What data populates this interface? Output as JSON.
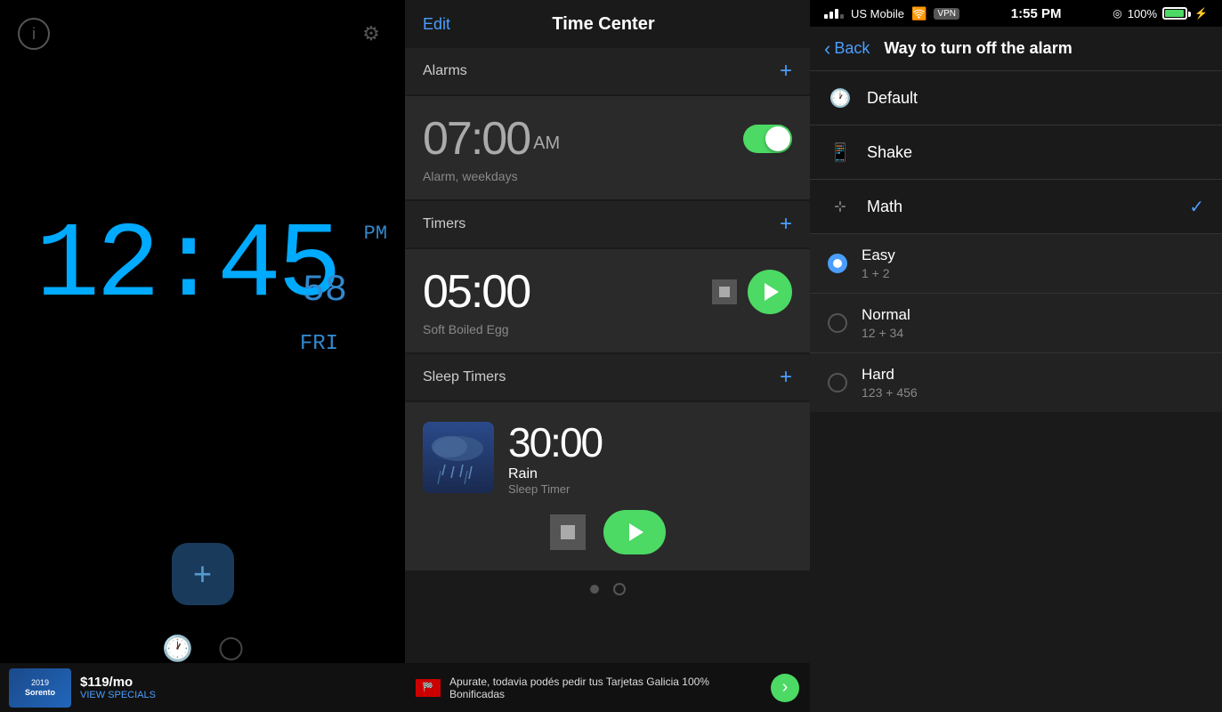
{
  "left": {
    "clock": {
      "time": "12:45",
      "seconds": "58",
      "period": "PM",
      "day": "FRI"
    },
    "info_label": "i",
    "settings_label": "⚙",
    "add_label": "+",
    "ad": {
      "year": "2019",
      "model": "Sorento",
      "price": "$119/mo",
      "cta": "VIEW SPECIALS"
    }
  },
  "center": {
    "edit_label": "Edit",
    "title": "Time Center",
    "sections": {
      "alarms": {
        "label": "Alarms",
        "add_icon": "+",
        "alarm": {
          "time": "07:00",
          "period": "AM",
          "description": "Alarm, weekdays",
          "toggle_on": true
        }
      },
      "timers": {
        "label": "Timers",
        "add_icon": "+",
        "timer": {
          "time": "05:00",
          "label": "Soft Boiled Egg"
        }
      },
      "sleep_timers": {
        "label": "Sleep Timers",
        "add_icon": "+",
        "timer": {
          "time": "30:00",
          "name": "Rain",
          "sublabel": "Sleep Timer"
        }
      }
    },
    "ad": {
      "text": "Apurate, todavia podés pedir tus Tarjetas Galicia 100% Bonificadas",
      "arrow": "›"
    }
  },
  "right": {
    "status_bar": {
      "carrier": "US Mobile",
      "vpn": "VPN",
      "time": "1:55 PM",
      "location_icon": "⊙",
      "percent": "100%",
      "charge_icon": "⚡"
    },
    "nav": {
      "back_label": "Back",
      "title": "Way to turn off the alarm"
    },
    "items": [
      {
        "id": "default",
        "icon": "🕐",
        "label": "Default",
        "checked": false
      },
      {
        "id": "shake",
        "icon": "📱",
        "label": "Shake",
        "checked": false
      },
      {
        "id": "math",
        "icon": "✦",
        "label": "Math",
        "checked": true
      }
    ],
    "sub_items": [
      {
        "id": "easy",
        "label": "Easy",
        "desc": "1 + 2",
        "checked": true
      },
      {
        "id": "normal",
        "label": "Normal",
        "desc": "12 + 34",
        "checked": false
      },
      {
        "id": "hard",
        "label": "Hard",
        "desc": "123 + 456",
        "checked": false
      }
    ]
  }
}
